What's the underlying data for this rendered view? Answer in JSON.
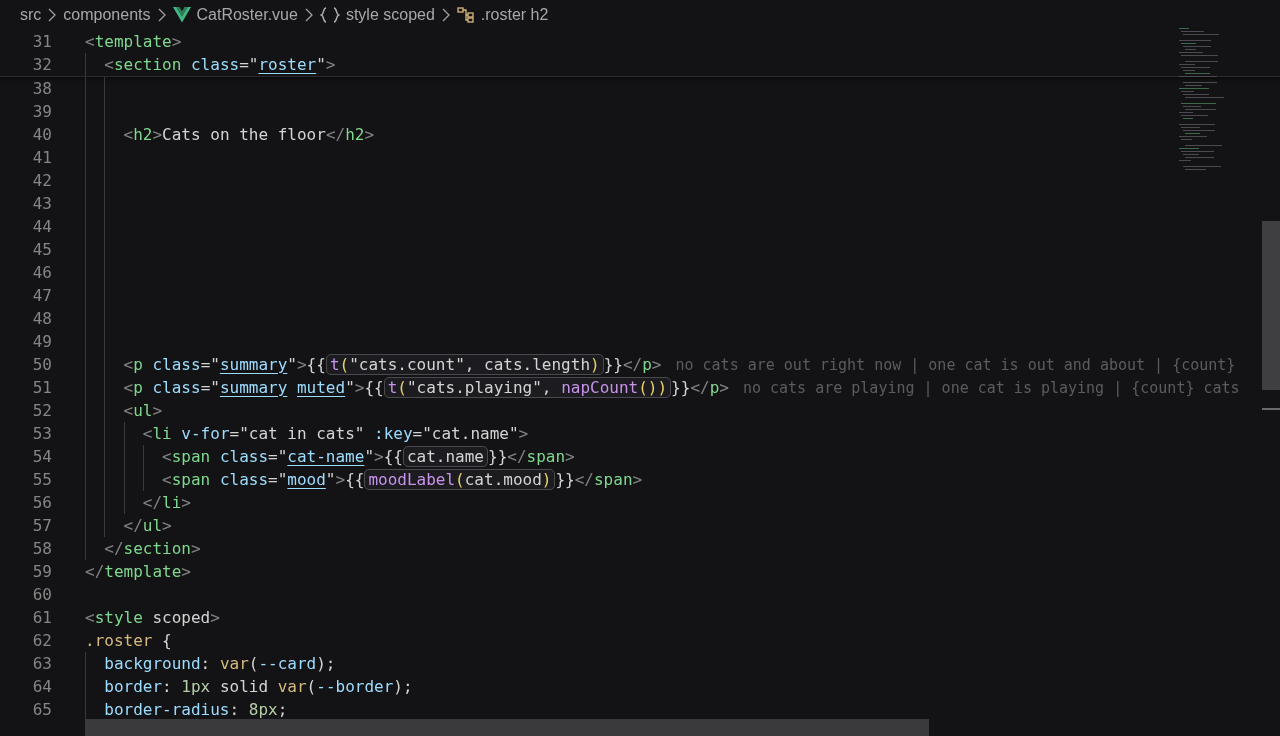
{
  "breadcrumbs": [
    {
      "label": "src",
      "kind": "folder"
    },
    {
      "label": "components",
      "kind": "folder"
    },
    {
      "label": "CatRoster.vue",
      "kind": "file"
    },
    {
      "label": "style scoped",
      "kind": "block"
    },
    {
      "label": ".roster h2",
      "kind": "symbol"
    }
  ],
  "sticky_lines": [
    {
      "number": "31",
      "segments": [
        {
          "kind": "code",
          "text": "<template>"
        }
      ]
    },
    {
      "number": "32",
      "segments": [
        {
          "kind": "code",
          "text": "  <section class=\""
        },
        {
          "kind": "link",
          "text": "roster"
        },
        {
          "kind": "code",
          "text": "\">"
        }
      ]
    }
  ],
  "lines": [
    {
      "number": "38"
    },
    {
      "number": "39"
    },
    {
      "number": "40",
      "segments": [
        {
          "kind": "code",
          "text": "    <h2>Cats on the floor</h2>"
        }
      ]
    },
    {
      "number": "41"
    },
    {
      "number": "42"
    },
    {
      "number": "43"
    },
    {
      "number": "44"
    },
    {
      "number": "45"
    },
    {
      "number": "46"
    },
    {
      "number": "47"
    },
    {
      "number": "48"
    },
    {
      "number": "49"
    },
    {
      "number": "50",
      "segments": [
        {
          "kind": "code",
          "text": "    <p class=\""
        },
        {
          "kind": "link",
          "text": "summary"
        },
        {
          "kind": "code",
          "text": "\">{{"
        },
        {
          "kind": "expr",
          "text": "t(\"cats.count\", cats.length)"
        },
        {
          "kind": "code",
          "text": "}}</p>"
        }
      ],
      "hint": "no cats are out right now | one cat is out and about | {count}"
    },
    {
      "number": "51",
      "segments": [
        {
          "kind": "code",
          "text": "    <p class=\""
        },
        {
          "kind": "link",
          "text": "summary muted"
        },
        {
          "kind": "code",
          "text": "\">{{"
        },
        {
          "kind": "expr",
          "text": "t(\"cats.playing\", napCount())"
        },
        {
          "kind": "code",
          "text": "}}</p>"
        }
      ],
      "hint": "no cats are playing | one cat is playing | {count} cats"
    },
    {
      "number": "52",
      "segments": [
        {
          "kind": "code",
          "text": "    <ul>"
        }
      ]
    },
    {
      "number": "53",
      "segments": [
        {
          "kind": "code",
          "text": "      <li v-for=\"cat in cats\" :key=\"cat.name\">"
        }
      ]
    },
    {
      "number": "54",
      "segments": [
        {
          "kind": "code",
          "text": "        <span class=\""
        },
        {
          "kind": "link",
          "text": "cat-name"
        },
        {
          "kind": "code",
          "text": "\">{{"
        },
        {
          "kind": "expr",
          "text": "cat.name"
        },
        {
          "kind": "code",
          "text": "}}</span>"
        }
      ]
    },
    {
      "number": "55",
      "segments": [
        {
          "kind": "code",
          "text": "        <span class=\""
        },
        {
          "kind": "link",
          "text": "mood"
        },
        {
          "kind": "code",
          "text": "\">{{"
        },
        {
          "kind": "expr",
          "text": "moodLabel(cat.mood)"
        },
        {
          "kind": "code",
          "text": "}}</span>"
        }
      ]
    },
    {
      "number": "56",
      "segments": [
        {
          "kind": "code",
          "text": "      </li>"
        }
      ]
    },
    {
      "number": "57",
      "segments": [
        {
          "kind": "code",
          "text": "    </ul>"
        }
      ]
    },
    {
      "number": "58",
      "segments": [
        {
          "kind": "code",
          "text": "  </section>"
        }
      ]
    },
    {
      "number": "59",
      "segments": [
        {
          "kind": "code",
          "text": "</template>"
        }
      ]
    },
    {
      "number": "60"
    },
    {
      "number": "61",
      "segments": [
        {
          "kind": "code",
          "text": "<style scoped>"
        }
      ]
    },
    {
      "number": "62",
      "segments": [
        {
          "kind": "code",
          "text": ".roster {"
        }
      ]
    },
    {
      "number": "63",
      "segments": [
        {
          "kind": "code",
          "text": "  background: var(--card);"
        }
      ]
    },
    {
      "number": "64",
      "segments": [
        {
          "kind": "code",
          "text": "  border: 1px solid var(--border);"
        }
      ]
    },
    {
      "number": "65",
      "segments": [
        {
          "kind": "code",
          "text": "  border-radius: 8px;"
        }
      ]
    }
  ]
}
